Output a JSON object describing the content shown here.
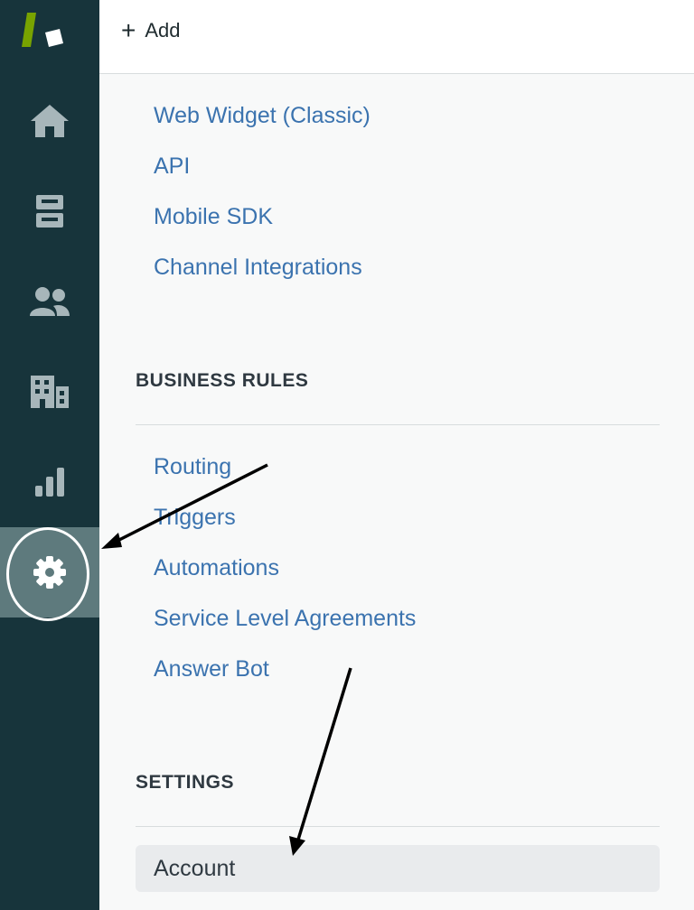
{
  "header": {
    "add_label": "Add"
  },
  "nav": {
    "items": [
      "home-icon",
      "views-icon",
      "customers-icon",
      "organizations-icon",
      "reporting-icon",
      "admin-icon"
    ],
    "active": "admin-icon"
  },
  "channels": {
    "links": [
      "Web Widget (Classic)",
      "API",
      "Mobile SDK",
      "Channel Integrations"
    ]
  },
  "business_rules": {
    "title": "BUSINESS RULES",
    "links": [
      "Routing",
      "Triggers",
      "Automations",
      "Service Level Agreements",
      "Answer Bot"
    ]
  },
  "settings": {
    "title": "SETTINGS",
    "selected": "Account"
  },
  "colors": {
    "rail": "#17343b",
    "active_nav": "#5e7a7d",
    "link": "#3b73af",
    "logo_green": "#78a300"
  }
}
